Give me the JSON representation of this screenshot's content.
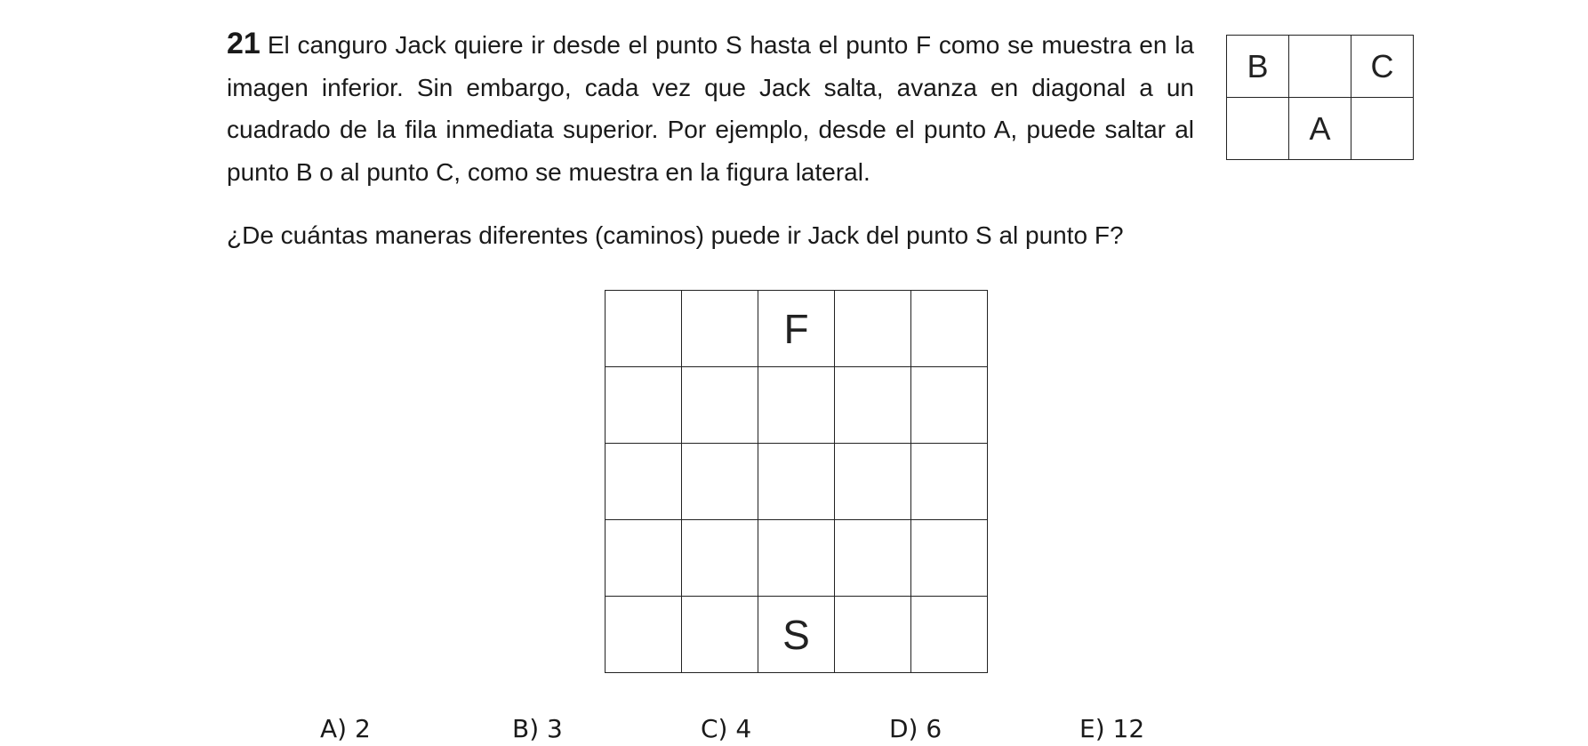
{
  "problem": {
    "number": "21",
    "text": "El canguro Jack quiere ir desde el punto S hasta el punto F como se muestra en la imagen inferior. Sin embargo, cada vez que Jack salta, avanza en diagonal a un cuadrado de la fila inmediata superior. Por ejemplo, desde el punto A, puede saltar al punto B o al punto C, como se muestra en la figura lateral.",
    "question": "¿De cuántas maneras diferentes (caminos) puede ir Jack del punto S al punto F?"
  },
  "small_grid": {
    "rows": [
      [
        "B",
        "",
        "C"
      ],
      [
        "",
        "A",
        ""
      ]
    ]
  },
  "main_grid": {
    "rows": [
      [
        "",
        "",
        "F",
        "",
        ""
      ],
      [
        "",
        "",
        "",
        "",
        ""
      ],
      [
        "",
        "",
        "",
        "",
        ""
      ],
      [
        "",
        "",
        "",
        "",
        ""
      ],
      [
        "",
        "",
        "S",
        "",
        ""
      ]
    ]
  },
  "answers": [
    "A) 2",
    "B) 3",
    "C) 4",
    "D) 6",
    "E) 12"
  ]
}
